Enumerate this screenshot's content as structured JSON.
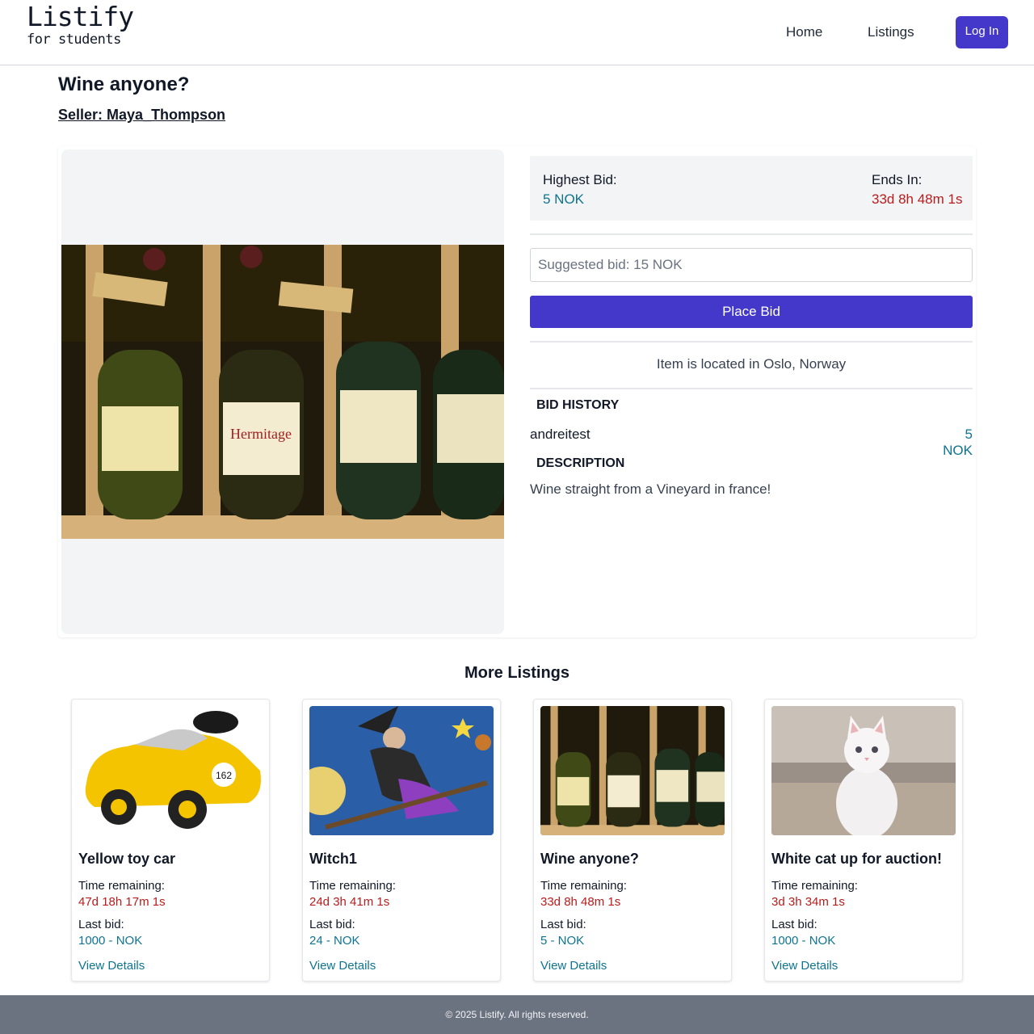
{
  "header": {
    "logo_title": "Listify",
    "logo_subtitle": "for students",
    "nav": {
      "home": "Home",
      "listings": "Listings"
    },
    "login_label": "Log In",
    "brand_color": "#4338ca"
  },
  "listing": {
    "title": "Wine anyone?",
    "seller": "Seller: Maya_Thompson",
    "highest_bid_label": "Highest Bid:",
    "highest_bid_value": "5 NOK",
    "ends_in_label": "Ends In:",
    "ends_in_value": "33d 8h 48m 1s",
    "bid_placeholder": "Suggested bid: 15 NOK",
    "place_bid_label": "Place Bid",
    "location": "Item is located in Oslo, Norway",
    "bid_history_heading": "BID HISTORY",
    "bid_history": [
      {
        "user": "andreitest",
        "amount": "5 NOK"
      }
    ],
    "description_heading": "DESCRIPTION",
    "description": "Wine straight from a Vineyard in france!",
    "image": "wine-bottles-photo"
  },
  "more_listings": {
    "heading": "More Listings",
    "time_label": "Time remaining:",
    "bid_label": "Last bid:",
    "link_label": "View Details",
    "items": [
      {
        "title": "Yellow toy car",
        "time": "47d 18h 17m 1s",
        "last_bid": "1000 - NOK",
        "image": "yellow-toy-car-photo"
      },
      {
        "title": "Witch1",
        "time": "24d 3h 41m 1s",
        "last_bid": "24 - NOK",
        "image": "witch-illustration"
      },
      {
        "title": "Wine anyone?",
        "time": "33d 8h 48m 1s",
        "last_bid": "5 - NOK",
        "image": "wine-bottles-photo"
      },
      {
        "title": "White cat up for auction!",
        "time": "3d 3h 34m 1s",
        "last_bid": "1000 - NOK",
        "image": "white-cat-photo"
      }
    ]
  },
  "footer": {
    "text": "© 2025 Listify. All rights reserved."
  }
}
